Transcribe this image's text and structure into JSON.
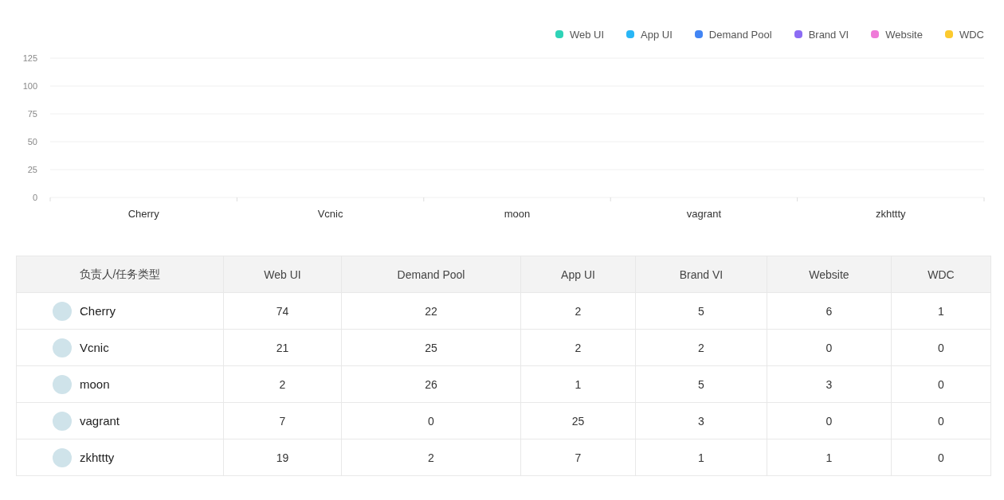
{
  "chart": {
    "chart_data": {
      "type": "bar",
      "grid": true,
      "categories": [
        "Cherry",
        "Vcnic",
        "moon",
        "vagrant",
        "zkhttty"
      ],
      "ylim": [
        0,
        125
      ],
      "yticks": [
        0,
        25,
        50,
        75,
        100,
        125
      ],
      "series": [
        {
          "name": "Web UI",
          "color": "#2ed3b7",
          "values": [
            null,
            null,
            null,
            null,
            null
          ]
        },
        {
          "name": "App UI",
          "color": "#29b6f6",
          "values": [
            null,
            null,
            null,
            null,
            null
          ]
        },
        {
          "name": "Demand Pool",
          "color": "#4285f4",
          "values": [
            null,
            null,
            null,
            null,
            null
          ]
        },
        {
          "name": "Brand VI",
          "color": "#8c6cf4",
          "values": [
            null,
            null,
            null,
            null,
            null
          ]
        },
        {
          "name": "Website",
          "color": "#ef7ad8",
          "values": [
            null,
            null,
            null,
            null,
            null
          ]
        },
        {
          "name": "WDC",
          "color": "#fcca2e",
          "values": [
            null,
            null,
            null,
            null,
            null
          ]
        }
      ]
    }
  },
  "table": {
    "columns": [
      "负责人/任务类型",
      "Web UI",
      "Demand Pool",
      "App UI",
      "Brand VI",
      "Website",
      "WDC"
    ],
    "rows": [
      {
        "cells": [
          "Cherry",
          "74",
          "22",
          "2",
          "5",
          "6",
          "1"
        ]
      },
      {
        "cells": [
          "Vcnic",
          "21",
          "25",
          "2",
          "2",
          "0",
          "0"
        ]
      },
      {
        "cells": [
          "moon",
          "2",
          "26",
          "1",
          "5",
          "3",
          "0"
        ]
      },
      {
        "cells": [
          "vagrant",
          "7",
          "0",
          "25",
          "3",
          "0",
          "0"
        ]
      },
      {
        "cells": [
          "zkhttty",
          "19",
          "2",
          "7",
          "1",
          "1",
          "0"
        ]
      }
    ]
  }
}
